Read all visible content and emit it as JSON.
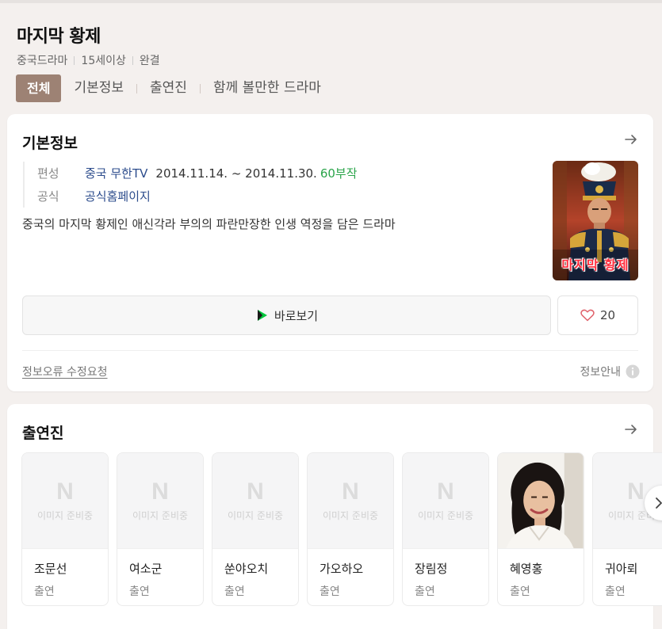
{
  "header": {
    "title": "마지막 황제",
    "meta": [
      "중국드라마",
      "15세이상",
      "완결"
    ],
    "tabs": [
      "전체",
      "기본정보",
      "출연진",
      "함께 볼만한 드라마"
    ]
  },
  "basic_info": {
    "section_title": "기본정보",
    "broadcast_label": "편성",
    "broadcaster": "중국 무한TV",
    "period": "2014.11.14. ~ 2014.11.30.",
    "episodes": "60부작",
    "official_label": "공식",
    "official_link": "공식홈페이지",
    "description": "중국의 마지막 황제인 애신각라 부의의 파란만장한 인생 역정을 담은 드라마",
    "poster_text": "마지막 황제",
    "watch_label": "바로보기",
    "like_count": "20",
    "report_label": "정보오류 수정요청",
    "guide_label": "정보안내"
  },
  "cast": {
    "section_title": "출연진",
    "no_image_label": "이미지 준비중",
    "placeholder_logo": "N",
    "members": [
      {
        "name": "조문선",
        "role": "출연"
      },
      {
        "name": "여소군",
        "role": "출연"
      },
      {
        "name": "쑨야오치",
        "role": "출연"
      },
      {
        "name": "가오하오",
        "role": "출연"
      },
      {
        "name": "장림정",
        "role": "출연"
      },
      {
        "name": "혜영홍",
        "role": "출연"
      },
      {
        "name": "귀아뢰",
        "role": "출연"
      }
    ]
  },
  "colors": {
    "tab_active": "#9d8274",
    "link": "#2c4c8c",
    "episodes": "#2aa44a",
    "heart": "#e0626b"
  }
}
